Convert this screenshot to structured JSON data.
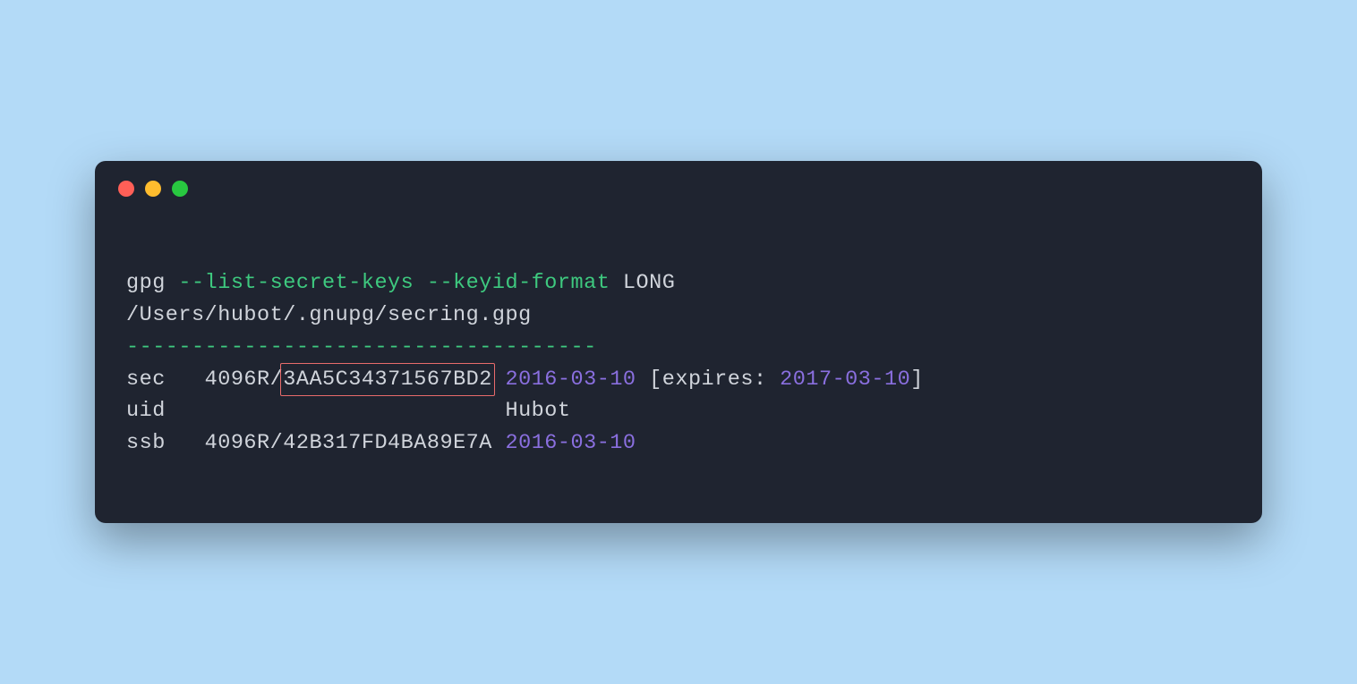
{
  "window": {
    "icons": {
      "close": "close",
      "minimize": "minimize",
      "zoom": "zoom"
    }
  },
  "terminal": {
    "cmd_name": "gpg",
    "flag1": " --list-secret-keys",
    "flag2": " --keyid-format",
    "arg": " LONG",
    "path": "/Users/hubot/.gnupg/secring.gpg",
    "separator": "------------------------------------",
    "sec_label": "sec   ",
    "sec_keytype": "4096R/",
    "sec_keyid": "3AA5C34371567BD2",
    "sec_date": "2016-03-10",
    "sec_expires_open": " [expires: ",
    "sec_expires_date": "2017-03-10",
    "sec_expires_close": "]",
    "uid_label": "uid                          ",
    "uid_name": "Hubot",
    "ssb_label": "ssb   ",
    "ssb_keytype": "4096R/42B317FD4BA89E7A ",
    "ssb_date": "2016-03-10"
  }
}
